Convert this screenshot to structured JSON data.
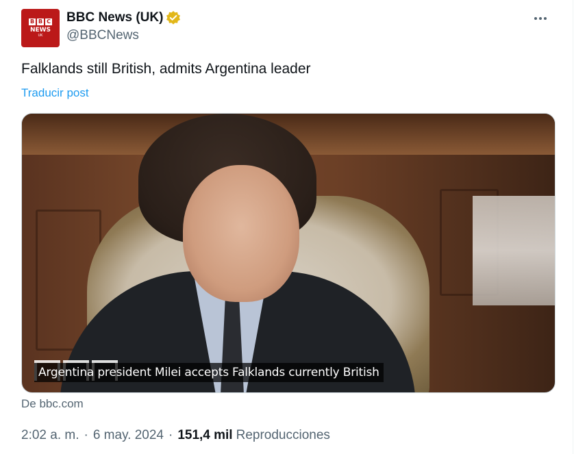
{
  "author": {
    "display_name": "BBC News (UK)",
    "handle": "@BBCNews",
    "avatar": {
      "blocks": [
        "B",
        "B",
        "C"
      ],
      "line1": "NEWS",
      "line2": "UK"
    },
    "verified_icon": "verified-gold-badge",
    "verified_color": "#e2b719"
  },
  "tweet": {
    "text": "Falklands still British, admits Argentina leader",
    "translate_label": "Traducir post"
  },
  "media": {
    "caption": "Argentina president Milei accepts Falklands currently British"
  },
  "card_source": "De bbc.com",
  "meta": {
    "time": "2:02 a. m.",
    "separator": "·",
    "date": "6 may. 2024",
    "views_count": "151,4 mil",
    "views_label": "Reproducciones"
  },
  "colors": {
    "text_primary": "#0f1419",
    "text_secondary": "#536471",
    "link": "#1d9bf0",
    "bbc_red": "#bb1919"
  }
}
